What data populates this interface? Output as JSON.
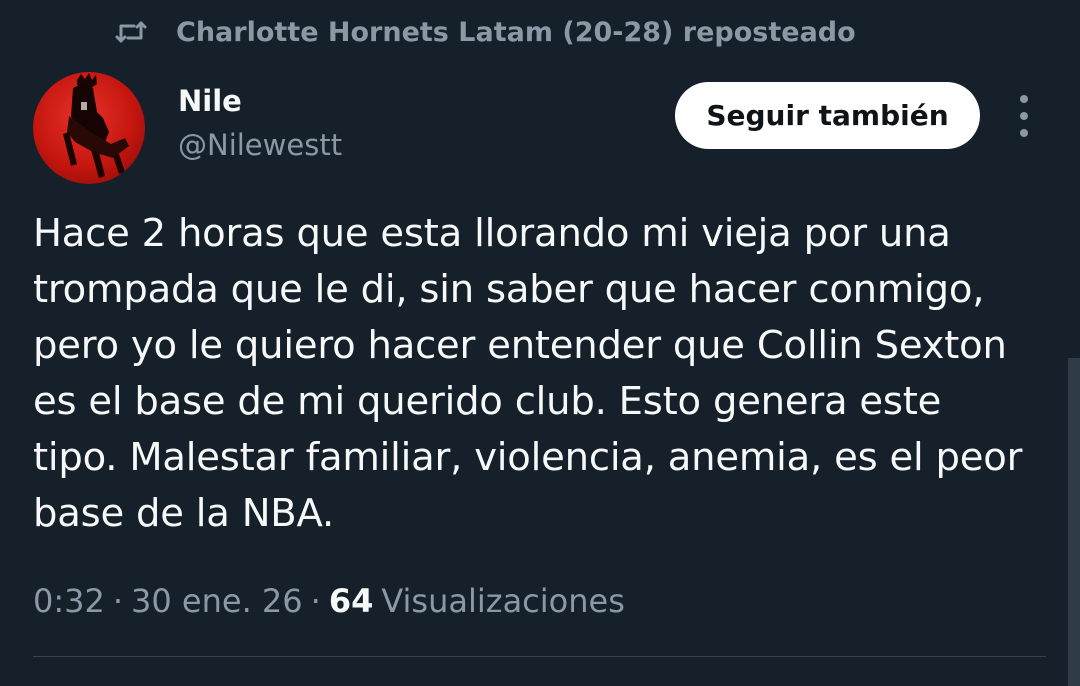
{
  "repost": {
    "icon": "repost-icon",
    "text": "Charlotte Hornets Latam (20-28) reposteado"
  },
  "author": {
    "avatar": "avatar",
    "name": "Nile",
    "handle": "@Nilewestt"
  },
  "actions": {
    "follow_label": "Seguir también",
    "more_icon": "more-options-icon"
  },
  "tweet": {
    "lines": [
      "Hace 2 horas que esta llorando mi vieja por una",
      "trompada que le di, sin saber que hacer conmigo,",
      "pero yo le quiero hacer entender que Collin Sexton",
      "es el base de mi querido club. Esto genera este",
      "tipo. Malestar familiar, violencia, anemia, es el peor",
      "base de la NBA."
    ]
  },
  "meta": {
    "time": "0:32",
    "separator": "·",
    "date": "30 ene. 26",
    "views_count": "64",
    "views_label": "Visualizaciones"
  },
  "colors": {
    "background": "#15202b",
    "primary_text": "#f7f9f9",
    "secondary_text": "#8b98a5",
    "button_bg": "#ffffff",
    "avatar_red": "#d71f17"
  }
}
